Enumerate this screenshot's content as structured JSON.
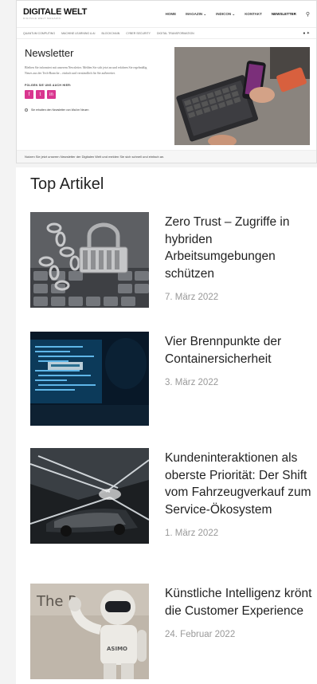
{
  "site": {
    "logo": "DIGITALE WELT",
    "tagline": "DIGITALE WELT MAGAZIN",
    "nav": [
      "HOME",
      "MAGAZIN ⌄",
      "INDICON ⌄",
      "KONTAKT",
      "NEWSLETTER"
    ],
    "subnav": [
      "QUANTUM COMPUTING",
      "MACHINE LEARNING & AI",
      "BLOCKCHAIN",
      "CYBER SECURITY",
      "DIGITAL TRANSFORMATION"
    ]
  },
  "newsletter": {
    "title": "Newsletter",
    "text": "Bleiben Sie informiert mit unserem Newsletter. Melden Sie sich jetzt an und erfahren Sie regelmäßig Neues aus der Tech-Branche – einfach und verständlich für Sie aufbereitet.",
    "follow_label": "FOLGEN SIE UNS AUCH HIER:",
    "social": [
      "f",
      "t",
      "in"
    ],
    "radio_label": "Sie erhalten den Newsletter von Wal im Neuen",
    "footer": "Nutzen Sie jetzt unseren Newsletter der Digitalen Welt und melden Sie sich schnell und einfach an."
  },
  "top_articles": {
    "heading": "Top Artikel",
    "items": [
      {
        "title": "Zero Trust – Zugriffe in hybriden Arbeitsumgebungen schützen",
        "date": "7. März 2022"
      },
      {
        "title": "Vier Brennpunkte der Containersicherheit",
        "date": "3. März 2022"
      },
      {
        "title": "Kundeninteraktionen als oberste Priorität: Der Shift vom Fahrzeugverkauf zum Service-Ökosystem",
        "date": "1. März 2022"
      },
      {
        "title": "Künstliche Intelligenz krönt die Customer Experience",
        "date": "24. Februar 2022"
      }
    ]
  },
  "thumb_text": {
    "robot_sign": "The P",
    "robot_brand": "ASIMO"
  },
  "colors": {
    "social_pink": "#d9368f"
  }
}
